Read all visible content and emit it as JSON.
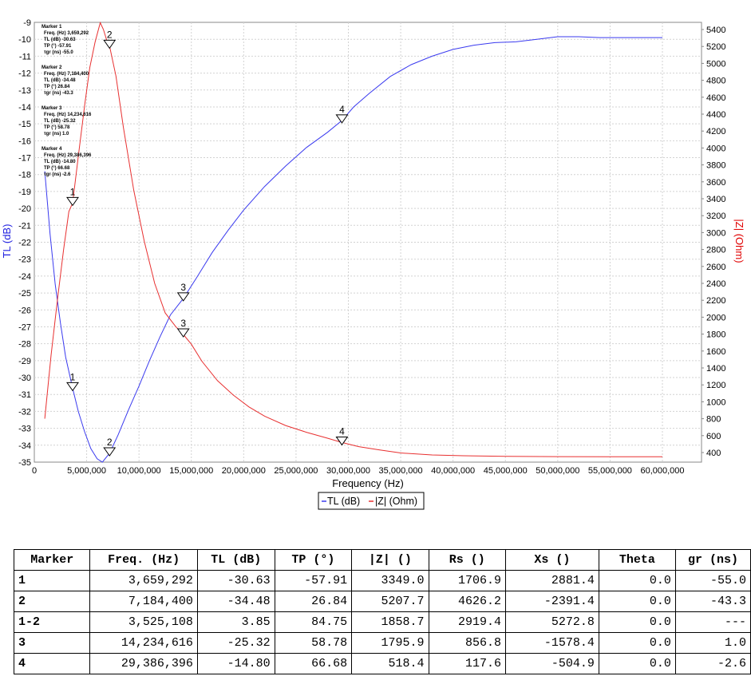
{
  "chart_data": {
    "type": "line",
    "xlabel": "Frequency (Hz)",
    "ylabel_left": "TL (dB)",
    "ylabel_right": "|Z| (Ohm)",
    "xlim": [
      0,
      62000000
    ],
    "ylim_left": [
      -35,
      -9
    ],
    "ylim_right": [
      300,
      5500
    ],
    "x_ticks": [
      "0",
      "5,000,000",
      "10,000,000",
      "15,000,000",
      "20,000,000",
      "25,000,000",
      "30,000,000",
      "35,000,000",
      "40,000,000",
      "45,000,000",
      "50,000,000",
      "55,000,000",
      "60,000,000"
    ],
    "y_left_ticks": [
      "-9",
      "-10",
      "-11",
      "-12",
      "-13",
      "-14",
      "-15",
      "-16",
      "-17",
      "-18",
      "-19",
      "-20",
      "-21",
      "-22",
      "-23",
      "-24",
      "-25",
      "-26",
      "-27",
      "-28",
      "-29",
      "-30",
      "-31",
      "-32",
      "-33",
      "-34",
      "-35"
    ],
    "y_right_ticks": [
      "400",
      "600",
      "800",
      "1000",
      "1200",
      "1400",
      "1600",
      "1800",
      "2000",
      "2200",
      "2400",
      "2600",
      "2800",
      "3000",
      "3200",
      "3400",
      "3600",
      "3800",
      "4000",
      "4200",
      "4400",
      "4600",
      "4800",
      "5000",
      "5200",
      "5400"
    ],
    "grid": true,
    "legend": [
      "TL (dB)",
      "|Z| (Ohm)"
    ],
    "legend_position": "bottom-center",
    "series": [
      {
        "name": "TL (dB)",
        "color": "#3a3aef",
        "axis": "left",
        "x": [
          1000000,
          1500000,
          2000000,
          2500000,
          3000000,
          3659292,
          4200000,
          4800000,
          5400000,
          6000000,
          6500000,
          7184400,
          8000000,
          9000000,
          10000000,
          11000000,
          12000000,
          13000000,
          14234616,
          15500000,
          17000000,
          18500000,
          20000000,
          22000000,
          24000000,
          26000000,
          28000000,
          29386396,
          30500000,
          32000000,
          34000000,
          36000000,
          38000000,
          40000000,
          42000000,
          44000000,
          46000000,
          48000000,
          50000000,
          52000000,
          54000000,
          56000000,
          58000000,
          60000000
        ],
        "y": [
          -17.8,
          -21.5,
          -24.5,
          -26.8,
          -28.8,
          -30.63,
          -32.0,
          -33.2,
          -34.2,
          -34.8,
          -35.0,
          -34.48,
          -33.4,
          -31.9,
          -30.5,
          -29.0,
          -27.6,
          -26.3,
          -25.32,
          -24.1,
          -22.6,
          -21.3,
          -20.1,
          -18.7,
          -17.5,
          -16.4,
          -15.5,
          -14.8,
          -14.0,
          -13.2,
          -12.2,
          -11.5,
          -11.0,
          -10.6,
          -10.35,
          -10.2,
          -10.15,
          -10.0,
          -9.85,
          -9.85,
          -9.9,
          -9.9,
          -9.9,
          -9.9
        ]
      },
      {
        "name": "|Z| (Ohm)",
        "color": "#e83030",
        "axis": "right",
        "x": [
          1000000,
          1600000,
          2200000,
          2800000,
          3300000,
          3659292,
          4200000,
          4800000,
          5300000,
          5800000,
          6300000,
          6600000,
          6900000,
          7184400,
          7800000,
          8500000,
          9500000,
          10500000,
          11500000,
          12500000,
          13500000,
          14234616,
          15000000,
          16000000,
          17500000,
          19000000,
          20500000,
          22000000,
          24000000,
          26000000,
          28000000,
          29386396,
          31000000,
          33000000,
          35000000,
          38000000,
          41000000,
          45000000,
          50000000,
          55000000,
          60000000
        ],
        "y": [
          800,
          1550,
          2200,
          2800,
          3250,
          3349.0,
          3900,
          4500,
          4950,
          5250,
          5480,
          5400,
          5280,
          5207.7,
          4850,
          4250,
          3500,
          2900,
          2400,
          2050,
          1890,
          1795.9,
          1680,
          1480,
          1250,
          1080,
          940,
          830,
          720,
          640,
          570,
          518.4,
          470,
          430,
          395,
          372,
          362,
          356,
          352,
          350,
          350
        ]
      }
    ],
    "markers": [
      {
        "id": "1",
        "series": 0,
        "x": 3659292,
        "y": -30.63
      },
      {
        "id": "1",
        "series": 1,
        "x": 3659292,
        "y": 3349.0
      },
      {
        "id": "2",
        "series": 0,
        "x": 7184400,
        "y": -34.48
      },
      {
        "id": "2",
        "series": 1,
        "x": 7184400,
        "y": 5207.7
      },
      {
        "id": "3",
        "series": 0,
        "x": 14234616,
        "y": -25.32
      },
      {
        "id": "3",
        "series": 1,
        "x": 14234616,
        "y": 1795.9
      },
      {
        "id": "4",
        "series": 0,
        "x": 29386396,
        "y": -14.8
      },
      {
        "id": "4",
        "series": 1,
        "x": 29386396,
        "y": 518.4
      }
    ],
    "annotations": [
      {
        "title": "Marker 1",
        "lines": [
          "Freq. (Hz) 3,659,292",
          "TL (dB)   -30.63",
          "TP (°)    -57.91",
          "τgr (ns)    -55.0"
        ]
      },
      {
        "title": "Marker 2",
        "lines": [
          "Freq. (Hz) 7,184,400",
          "TL (dB)   -34.48",
          "TP (°)     26.84",
          "τgr (ns)    -43.3"
        ]
      },
      {
        "title": "Marker 3",
        "lines": [
          "Freq. (Hz) 14,234,616",
          "TL (dB)   -25.32",
          "TP (°)     58.78",
          "τgr (ns)     1.0"
        ]
      },
      {
        "title": "Marker 4",
        "lines": [
          "Freq. (Hz) 29,386,396",
          "TL (dB)   -14.80",
          "TP (°)     66.68",
          "τgr (ns)    -2.6"
        ]
      }
    ]
  },
  "table": {
    "headers": [
      "Marker",
      "Freq. (Hz)",
      "TL (dB)",
      "TP (°)",
      "|Z| ()",
      "Rs ()",
      "Xs ()",
      "Theta",
      "gr (ns)"
    ],
    "rows": [
      [
        "1",
        "3,659,292",
        "-30.63",
        "-57.91",
        "3349.0",
        "1706.9",
        "2881.4",
        "0.0",
        "-55.0"
      ],
      [
        "2",
        "7,184,400",
        "-34.48",
        "26.84",
        "5207.7",
        "4626.2",
        "-2391.4",
        "0.0",
        "-43.3"
      ],
      [
        "1-2",
        "3,525,108",
        "3.85",
        "84.75",
        "1858.7",
        "2919.4",
        "5272.8",
        "0.0",
        "---"
      ],
      [
        "3",
        "14,234,616",
        "-25.32",
        "58.78",
        "1795.9",
        "856.8",
        "-1578.4",
        "0.0",
        "1.0"
      ],
      [
        "4",
        "29,386,396",
        "-14.80",
        "66.68",
        "518.4",
        "117.6",
        "-504.9",
        "0.0",
        "-2.6"
      ]
    ]
  }
}
